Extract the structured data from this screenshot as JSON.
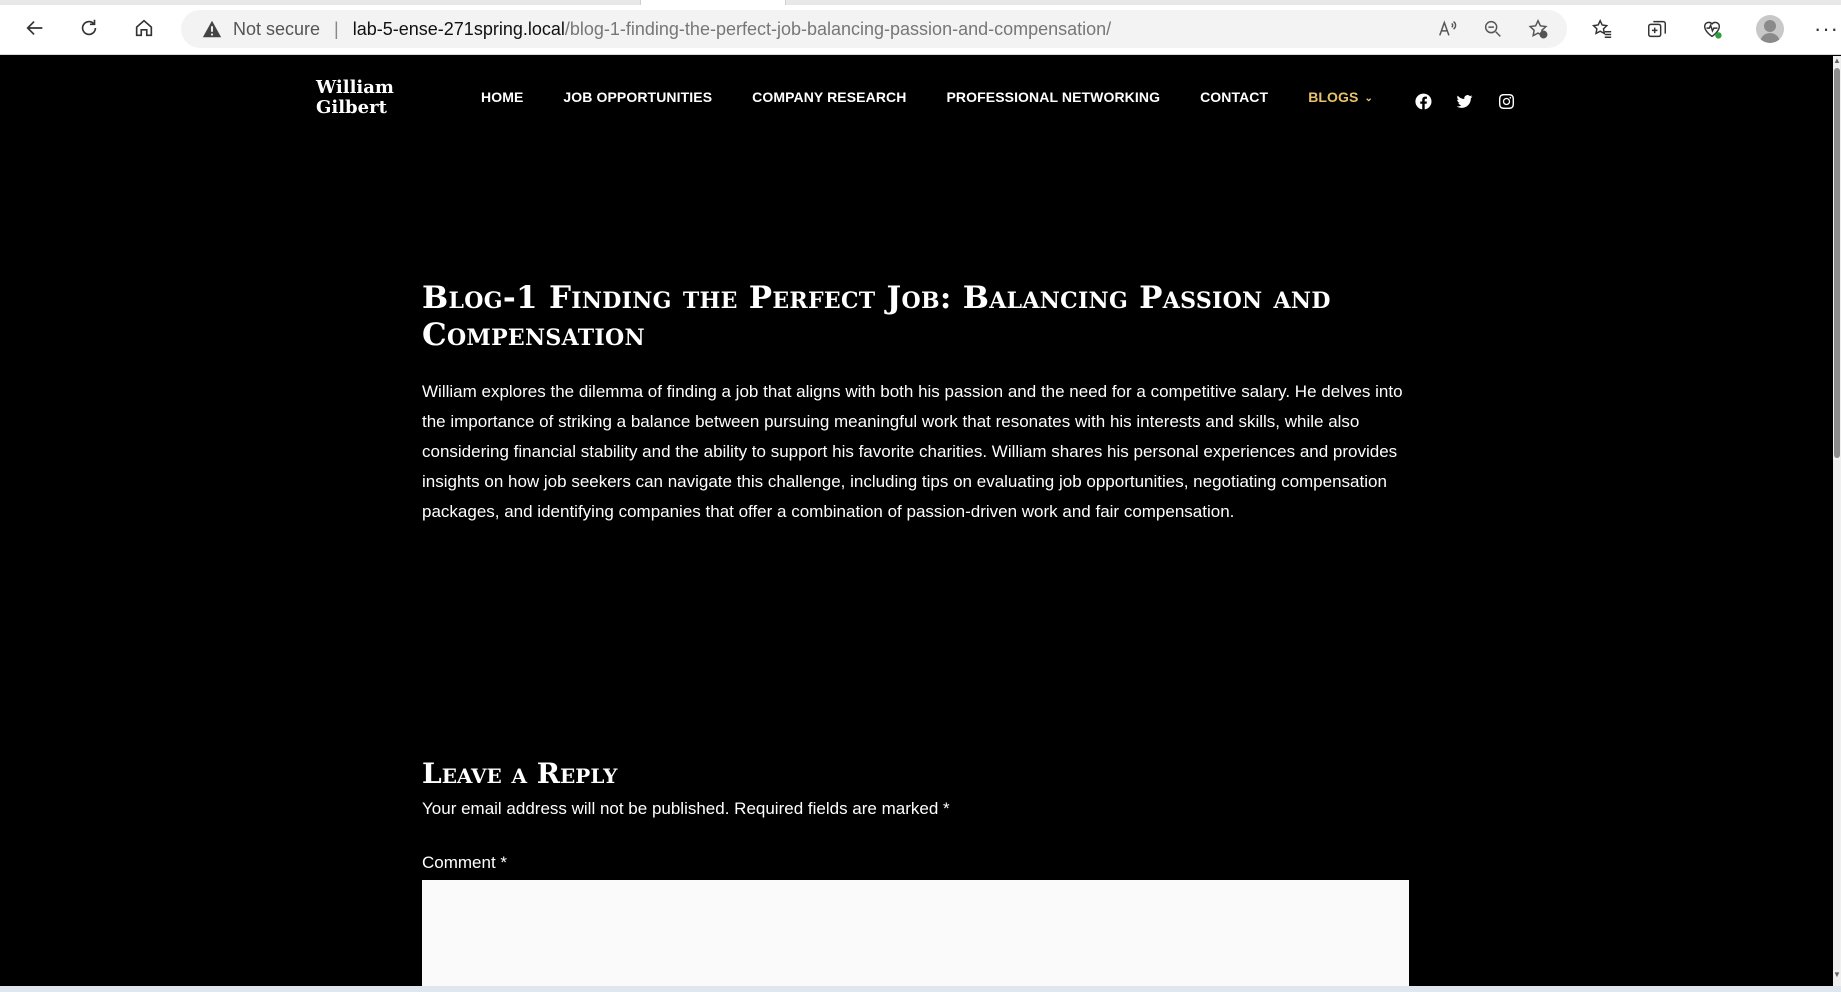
{
  "browser": {
    "address": {
      "security_label": "Not secure",
      "separator": "|",
      "host": "lab-5-ense-271spring.local",
      "path": "/blog-1-finding-the-perfect-job-balancing-passion-and-compensation/"
    },
    "icons": [
      "back-icon",
      "refresh-icon",
      "home-icon",
      "warning-icon",
      "read-aloud-icon",
      "zoom-out-icon",
      "add-favorite-icon",
      "favorites-icon",
      "collections-icon",
      "browser-essentials-icon",
      "profile-avatar",
      "more-icon"
    ]
  },
  "site": {
    "logo_line1": "William",
    "logo_line2": "Gilbert",
    "nav": [
      {
        "label": "HOME"
      },
      {
        "label": "JOB OPPORTUNITIES"
      },
      {
        "label": "COMPANY RESEARCH"
      },
      {
        "label": "PROFESSIONAL NETWORKING"
      },
      {
        "label": "CONTACT"
      },
      {
        "label": "BLOGS"
      }
    ],
    "active_nav_color": "#e8c36a",
    "social": [
      "facebook-icon",
      "twitter-icon",
      "instagram-icon"
    ]
  },
  "article": {
    "title": "Blog-1 Finding the Perfect Job: Balancing Passion and Compensation",
    "body": "William explores the dilemma of finding a job that aligns with both his passion and the need for a competitive salary. He delves into the importance of striking a balance between pursuing meaningful work that resonates with his interests and skills, while also considering financial stability and the ability to support his favorite charities. William shares his personal experiences and provides insights on how job seekers can navigate this challenge, including tips on evaluating job opportunities, negotiating compensation packages, and identifying companies that offer a combination of passion-driven work and fair compensation."
  },
  "reply": {
    "title": "Leave a Reply",
    "note": "Your email address will not be published. Required fields are marked *",
    "comment_label": "Comment *"
  }
}
